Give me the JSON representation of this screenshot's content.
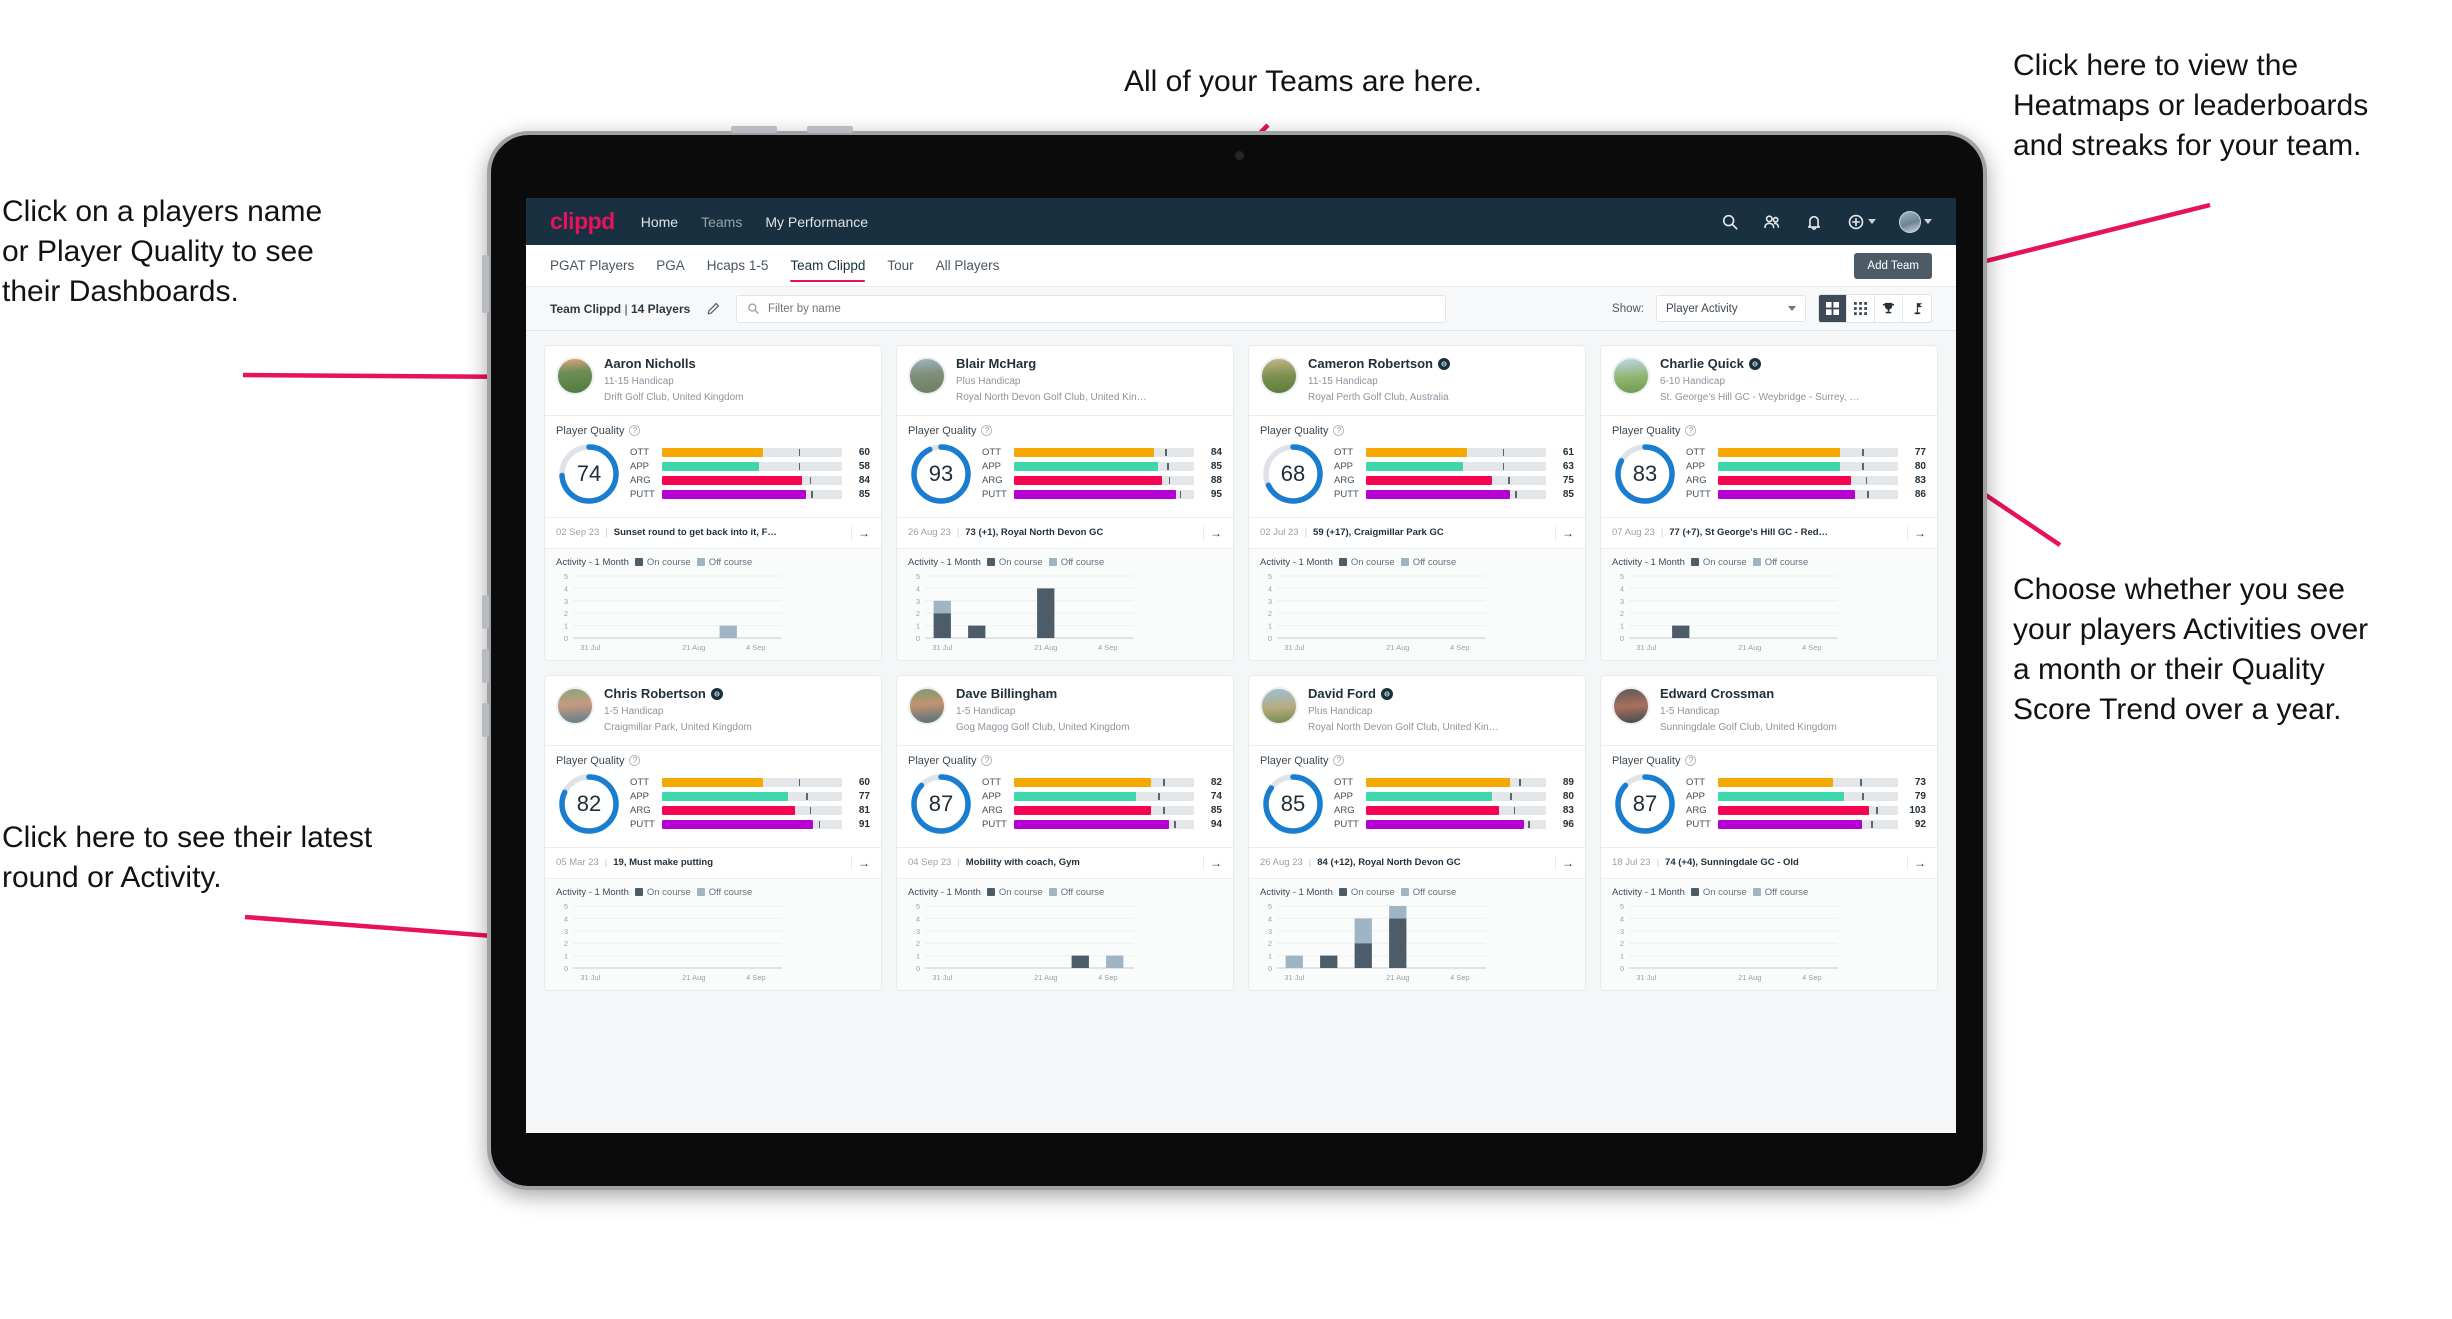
{
  "annotations": {
    "left_top": "Click on a players name\nor Player Quality to see\ntheir Dashboards.",
    "left_bottom": "Click here to see their latest\nround or Activity.",
    "top": "All of your Teams are here.",
    "right_top": "Click here to view the\nHeatmaps or leaderboards\nand streaks for your team.",
    "right_bottom": "Choose whether you see\nyour players Activities over\na month or their Quality\nScore Trend over a year.",
    "arrow_color": "#e8115b"
  },
  "topnav": {
    "logo": "clippd",
    "links": [
      {
        "label": "Home",
        "active": true
      },
      {
        "label": "Teams",
        "active": false
      },
      {
        "label": "My Performance",
        "active": true
      }
    ],
    "icons": [
      "search-icon",
      "people-icon",
      "bell-icon",
      "plus-circle-icon",
      "avatar"
    ],
    "bg": "#18303f"
  },
  "tabs": {
    "items": [
      {
        "label": "PGAT Players",
        "active": false
      },
      {
        "label": "PGA",
        "active": false
      },
      {
        "label": "Hcaps 1-5",
        "active": false
      },
      {
        "label": "Team Clippd",
        "active": true
      },
      {
        "label": "Tour",
        "active": false
      },
      {
        "label": "All Players",
        "active": false
      }
    ],
    "add_team_label": "Add Team",
    "active_underline_color": "#e8115b"
  },
  "filterbar": {
    "team_name": "Team Clippd",
    "team_count": "14 Players",
    "separator": "|",
    "edit_icon": "pencil-icon",
    "search_placeholder": "Filter by name",
    "search_value": "",
    "show_label": "Show:",
    "show_value": "Player Activity",
    "view_buttons": [
      {
        "name": "grid-large-icon",
        "active": true
      },
      {
        "name": "grid-small-icon",
        "active": false
      },
      {
        "name": "trophy-icon",
        "active": false
      },
      {
        "name": "flag-icon",
        "active": false
      }
    ]
  },
  "card_labels": {
    "player_quality": "Player Quality",
    "help_icon": "question-mark-icon",
    "activity_title": "Activity - 1 Month",
    "legend_on": "On course",
    "legend_off": "Off course",
    "arrow_icon": "arrow-right-icon",
    "metric_labels": [
      "OTT",
      "APP",
      "ARG",
      "PUTT"
    ],
    "x_ticks": [
      "31 Jul",
      "21 Aug",
      "4 Sep"
    ],
    "y_ticks": [
      "5",
      "4",
      "3",
      "2",
      "1",
      "0"
    ]
  },
  "colors": {
    "ott": "#f5a800",
    "app": "#3ed6ab",
    "arg": "#f5054f",
    "putt": "#b400d1",
    "ring": "#1a7dd0",
    "ring_track": "#dfe3e7",
    "on_course": "#4c5d69",
    "off_course": "#9fb5c6"
  },
  "players": [
    {
      "name": "Aaron Nicholls",
      "verified": false,
      "handicap": "11-15 Handicap",
      "club": "Drift Golf Club, United Kingdom",
      "quality": 74,
      "metrics": [
        {
          "label": "OTT",
          "value": 60,
          "fill": 56,
          "tick": 76
        },
        {
          "label": "APP",
          "value": 58,
          "fill": 54,
          "tick": 76
        },
        {
          "label": "ARG",
          "value": 84,
          "fill": 78,
          "tick": 82
        },
        {
          "label": "PUTT",
          "value": 85,
          "fill": 80,
          "tick": 83
        }
      ],
      "latest_date": "02 Sep 23",
      "latest_text": "Sunset round to get back into it, F…",
      "chart_data": {
        "type": "bar",
        "title": "Activity - 1 Month",
        "categories": [
          "31 Jul",
          "7 Aug",
          "14 Aug",
          "21 Aug",
          "28 Aug",
          "4 Sep"
        ],
        "series": [
          {
            "name": "On course",
            "values": [
              0,
              0,
              0,
              0,
              0,
              0
            ]
          },
          {
            "name": "Off course",
            "values": [
              0,
              0,
              0,
              0,
              1,
              0
            ]
          }
        ],
        "ylim": [
          0,
          5
        ],
        "ylabel": "",
        "xlabel": "",
        "grid": true
      }
    },
    {
      "name": "Blair McHarg",
      "verified": false,
      "handicap": "Plus Handicap",
      "club": "Royal North Devon Golf Club, United Kin…",
      "quality": 93,
      "metrics": [
        {
          "label": "OTT",
          "value": 84,
          "fill": 78,
          "tick": 84
        },
        {
          "label": "APP",
          "value": 85,
          "fill": 80,
          "tick": 85
        },
        {
          "label": "ARG",
          "value": 88,
          "fill": 82,
          "tick": 86
        },
        {
          "label": "PUTT",
          "value": 95,
          "fill": 90,
          "tick": 92
        }
      ],
      "latest_date": "26 Aug 23",
      "latest_text": "73 (+1), Royal North Devon GC",
      "chart_data": {
        "type": "bar",
        "title": "Activity - 1 Month",
        "categories": [
          "31 Jul",
          "7 Aug",
          "14 Aug",
          "21 Aug",
          "28 Aug",
          "4 Sep"
        ],
        "series": [
          {
            "name": "On course",
            "values": [
              2,
              1,
              0,
              4,
              0,
              0
            ]
          },
          {
            "name": "Off course",
            "values": [
              1,
              0,
              0,
              0,
              0,
              0
            ]
          }
        ],
        "ylim": [
          0,
          5
        ],
        "ylabel": "",
        "xlabel": "",
        "grid": true
      }
    },
    {
      "name": "Cameron Robertson",
      "verified": true,
      "handicap": "11-15 Handicap",
      "club": "Royal Perth Golf Club, Australia",
      "quality": 68,
      "metrics": [
        {
          "label": "OTT",
          "value": 61,
          "fill": 56,
          "tick": 76
        },
        {
          "label": "APP",
          "value": 63,
          "fill": 54,
          "tick": 76
        },
        {
          "label": "ARG",
          "value": 75,
          "fill": 70,
          "tick": 79
        },
        {
          "label": "PUTT",
          "value": 85,
          "fill": 80,
          "tick": 83
        }
      ],
      "latest_date": "02 Jul 23",
      "latest_text": "59 (+17), Craigmillar Park GC",
      "chart_data": {
        "type": "bar",
        "title": "Activity - 1 Month",
        "categories": [
          "31 Jul",
          "7 Aug",
          "14 Aug",
          "21 Aug",
          "28 Aug",
          "4 Sep"
        ],
        "series": [
          {
            "name": "On course",
            "values": [
              0,
              0,
              0,
              0,
              0,
              0
            ]
          },
          {
            "name": "Off course",
            "values": [
              0,
              0,
              0,
              0,
              0,
              0
            ]
          }
        ],
        "ylim": [
          0,
          5
        ],
        "ylabel": "",
        "xlabel": "",
        "grid": true
      }
    },
    {
      "name": "Charlie Quick",
      "verified": true,
      "handicap": "6-10 Handicap",
      "club": "St. George's Hill GC - Weybridge - Surrey, …",
      "quality": 83,
      "metrics": [
        {
          "label": "OTT",
          "value": 77,
          "fill": 68,
          "tick": 80
        },
        {
          "label": "APP",
          "value": 80,
          "fill": 68,
          "tick": 80
        },
        {
          "label": "ARG",
          "value": 83,
          "fill": 74,
          "tick": 82
        },
        {
          "label": "PUTT",
          "value": 86,
          "fill": 76,
          "tick": 83
        }
      ],
      "latest_date": "07 Aug 23",
      "latest_text": "77 (+7), St George's Hill GC - Red…",
      "chart_data": {
        "type": "bar",
        "title": "Activity - 1 Month",
        "categories": [
          "31 Jul",
          "7 Aug",
          "14 Aug",
          "21 Aug",
          "28 Aug",
          "4 Sep"
        ],
        "series": [
          {
            "name": "On course",
            "values": [
              0,
              1,
              0,
              0,
              0,
              0
            ]
          },
          {
            "name": "Off course",
            "values": [
              0,
              0,
              0,
              0,
              0,
              0
            ]
          }
        ],
        "ylim": [
          0,
          5
        ],
        "ylabel": "",
        "xlabel": "",
        "grid": true
      }
    },
    {
      "name": "Chris Robertson",
      "verified": true,
      "handicap": "1-5 Handicap",
      "club": "Craigmillar Park, United Kingdom",
      "quality": 82,
      "metrics": [
        {
          "label": "OTT",
          "value": 60,
          "fill": 56,
          "tick": 76
        },
        {
          "label": "APP",
          "value": 77,
          "fill": 70,
          "tick": 80
        },
        {
          "label": "ARG",
          "value": 81,
          "fill": 74,
          "tick": 82
        },
        {
          "label": "PUTT",
          "value": 91,
          "fill": 84,
          "tick": 87
        }
      ],
      "latest_date": "05 Mar 23",
      "latest_text": "19, Must make putting",
      "chart_data": {
        "type": "bar",
        "title": "Activity - 1 Month",
        "categories": [
          "31 Jul",
          "7 Aug",
          "14 Aug",
          "21 Aug",
          "28 Aug",
          "4 Sep"
        ],
        "series": [
          {
            "name": "On course",
            "values": [
              0,
              0,
              0,
              0,
              0,
              0
            ]
          },
          {
            "name": "Off course",
            "values": [
              0,
              0,
              0,
              0,
              0,
              0
            ]
          }
        ],
        "ylim": [
          0,
          5
        ],
        "ylabel": "",
        "xlabel": "",
        "grid": true
      }
    },
    {
      "name": "Dave Billingham",
      "verified": false,
      "handicap": "1-5 Handicap",
      "club": "Gog Magog Golf Club, United Kingdom",
      "quality": 87,
      "metrics": [
        {
          "label": "OTT",
          "value": 82,
          "fill": 76,
          "tick": 83
        },
        {
          "label": "APP",
          "value": 74,
          "fill": 68,
          "tick": 80
        },
        {
          "label": "ARG",
          "value": 85,
          "fill": 76,
          "tick": 83
        },
        {
          "label": "PUTT",
          "value": 94,
          "fill": 86,
          "tick": 89
        }
      ],
      "latest_date": "04 Sep 23",
      "latest_text": "Mobility with coach, Gym",
      "chart_data": {
        "type": "bar",
        "title": "Activity - 1 Month",
        "categories": [
          "31 Jul",
          "7 Aug",
          "14 Aug",
          "21 Aug",
          "28 Aug",
          "4 Sep"
        ],
        "series": [
          {
            "name": "On course",
            "values": [
              0,
              0,
              0,
              0,
              1,
              0
            ]
          },
          {
            "name": "Off course",
            "values": [
              0,
              0,
              0,
              0,
              0,
              1
            ]
          }
        ],
        "ylim": [
          0,
          5
        ],
        "ylabel": "",
        "xlabel": "",
        "grid": true
      }
    },
    {
      "name": "David Ford",
      "verified": true,
      "handicap": "Plus Handicap",
      "club": "Royal North Devon Golf Club, United Kin…",
      "quality": 85,
      "metrics": [
        {
          "label": "OTT",
          "value": 89,
          "fill": 80,
          "tick": 85
        },
        {
          "label": "APP",
          "value": 80,
          "fill": 70,
          "tick": 80
        },
        {
          "label": "ARG",
          "value": 83,
          "fill": 74,
          "tick": 82
        },
        {
          "label": "PUTT",
          "value": 96,
          "fill": 88,
          "tick": 90
        }
      ],
      "latest_date": "26 Aug 23",
      "latest_text": "84 (+12), Royal North Devon GC",
      "chart_data": {
        "type": "bar",
        "title": "Activity - 1 Month",
        "categories": [
          "31 Jul",
          "7 Aug",
          "14 Aug",
          "21 Aug",
          "28 Aug",
          "4 Sep"
        ],
        "series": [
          {
            "name": "On course",
            "values": [
              0,
              1,
              2,
              4,
              0,
              0
            ]
          },
          {
            "name": "Off course",
            "values": [
              1,
              0,
              2,
              1,
              0,
              0
            ]
          }
        ],
        "ylim": [
          0,
          5
        ],
        "ylabel": "",
        "xlabel": "",
        "grid": true
      }
    },
    {
      "name": "Edward Crossman",
      "verified": false,
      "handicap": "1-5 Handicap",
      "club": "Sunningdale Golf Club, United Kingdom",
      "quality": 87,
      "metrics": [
        {
          "label": "OTT",
          "value": 73,
          "fill": 64,
          "tick": 79
        },
        {
          "label": "APP",
          "value": 79,
          "fill": 70,
          "tick": 80
        },
        {
          "label": "ARG",
          "value": 103,
          "fill": 84,
          "tick": 88
        },
        {
          "label": "PUTT",
          "value": 92,
          "fill": 80,
          "tick": 85
        }
      ],
      "latest_date": "18 Jul 23",
      "latest_text": "74 (+4), Sunningdale GC - Old",
      "chart_data": {
        "type": "bar",
        "title": "Activity - 1 Month",
        "categories": [
          "31 Jul",
          "7 Aug",
          "14 Aug",
          "21 Aug",
          "28 Aug",
          "4 Sep"
        ],
        "series": [
          {
            "name": "On course",
            "values": [
              0,
              0,
              0,
              0,
              0,
              0
            ]
          },
          {
            "name": "Off course",
            "values": [
              0,
              0,
              0,
              0,
              0,
              0
            ]
          }
        ],
        "ylim": [
          0,
          5
        ],
        "ylabel": "",
        "xlabel": "",
        "grid": true
      }
    }
  ]
}
